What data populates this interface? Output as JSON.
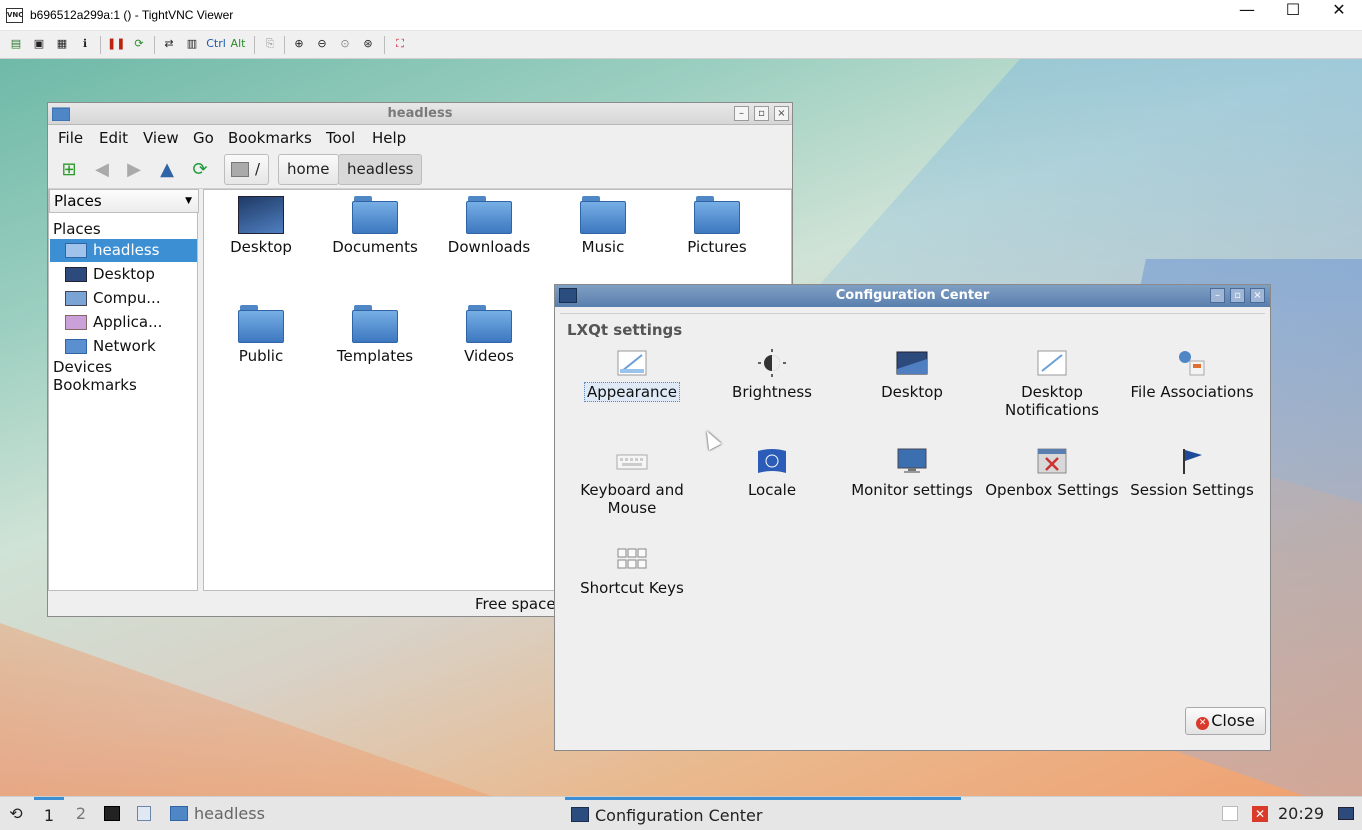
{
  "vnc": {
    "title": "b696512a299a:1 () - TightVNC Viewer",
    "logo": "VNC",
    "controls": {
      "minimize": "—",
      "maximize": "☐",
      "close": "✕"
    },
    "toolbar_icons": [
      "new-connection-icon",
      "save-icon",
      "options-icon",
      "info-icon",
      "pause-icon",
      "refresh-icon",
      "transfer-icon",
      "ctrl-alt-del-icon",
      "ctrl-key-icon",
      "alt-key-icon",
      "clipboard-icon",
      "zoom-in-icon",
      "zoom-out-icon",
      "zoom-100-icon",
      "zoom-fit-icon",
      "fullscreen-icon"
    ],
    "toolbar_labels": {
      "ctrl": "Ctrl",
      "alt": "Alt"
    }
  },
  "file_manager": {
    "title": "headless",
    "menu": [
      "File",
      "Edit",
      "View",
      "Go",
      "Bookmarks",
      "Tool",
      "Help"
    ],
    "path": [
      "/",
      "home",
      "headless"
    ],
    "places_combo": "Places",
    "sidebar": {
      "places_header": "Places",
      "items": [
        {
          "label": "headless",
          "selected": true,
          "icon": "home-folder-icon"
        },
        {
          "label": "Desktop",
          "selected": false,
          "icon": "desktop-icon"
        },
        {
          "label": "Compu...",
          "selected": false,
          "icon": "computer-icon"
        },
        {
          "label": "Applica...",
          "selected": false,
          "icon": "applications-icon"
        },
        {
          "label": "Network",
          "selected": false,
          "icon": "network-folder-icon"
        }
      ],
      "devices_header": "Devices",
      "bookmarks_header": "Bookmarks"
    },
    "files": [
      "Desktop",
      "Documents",
      "Downloads",
      "Music",
      "Pictures",
      "Public",
      "Templates",
      "Videos"
    ],
    "status": "Free space"
  },
  "config_center": {
    "title": "Configuration Center",
    "group": "LXQt settings",
    "items": [
      {
        "label": "Appearance",
        "icon": "appearance-icon"
      },
      {
        "label": "Brightness",
        "icon": "brightness-icon"
      },
      {
        "label": "Desktop",
        "icon": "desktop-settings-icon"
      },
      {
        "label": "Desktop Notifications",
        "icon": "notifications-icon"
      },
      {
        "label": "File Associations",
        "icon": "file-associations-icon"
      },
      {
        "label": "Keyboard and Mouse",
        "icon": "keyboard-icon"
      },
      {
        "label": "Locale",
        "icon": "locale-icon"
      },
      {
        "label": "Monitor settings",
        "icon": "monitor-icon"
      },
      {
        "label": "Openbox Settings",
        "icon": "openbox-icon"
      },
      {
        "label": "Session Settings",
        "icon": "session-flag-icon"
      },
      {
        "label": "Shortcut Keys",
        "icon": "shortcut-keys-icon"
      }
    ],
    "close_label": "Close"
  },
  "taskbar": {
    "desktops": [
      "1",
      "2"
    ],
    "tasks": [
      "headless",
      "Configuration Center"
    ],
    "clock": "20:29"
  }
}
